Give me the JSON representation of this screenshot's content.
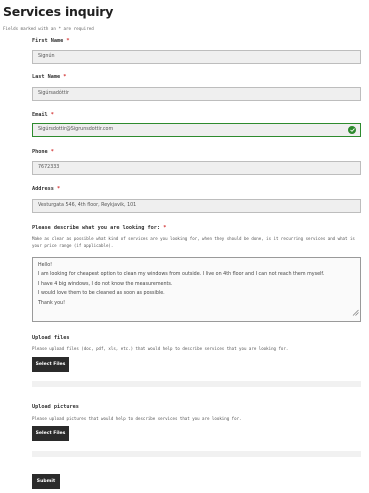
{
  "form": {
    "title": "Services inquiry",
    "required_note": "Fields marked with an * are required",
    "fields": {
      "first_name": {
        "label": "First Name",
        "required": "*",
        "value": "Signún"
      },
      "last_name": {
        "label": "Last Name",
        "required": "*",
        "value": "Sigúrsadóttir"
      },
      "email": {
        "label": "Email",
        "required": "*",
        "value": "Sigúrsdottir@Sigrunsdottir.com",
        "status_icon": "check-circle-icon"
      },
      "phone": {
        "label": "Phone",
        "required": "*",
        "value": "7672333"
      },
      "address": {
        "label": "Address",
        "required": "*",
        "value": "Vesturgata 546, 4th floor, Reykjavik, 101"
      },
      "description": {
        "label": "Please describe what you are looking for:",
        "required": "*",
        "help": "Make as clear as possible what kind of services are you looking for, when they should be done, is it recurring services and what is your price range (if applicable).",
        "lines": [
          "Hello!",
          "I am looking for cheapest option to clean my windows from outside. I live on 4th floor and I can not reach them myself.",
          "I have 4 big windows, I do not know the measurements.",
          "I would love them to be cleaned as soon as possible.",
          "Thank you!"
        ]
      }
    },
    "upload_files": {
      "label": "Upload files",
      "help": "Please upload files (doc, pdf, xls, etc.) that would help to describe services that you are looking for.",
      "button": "Select Files"
    },
    "upload_pictures": {
      "label": "Upload pictures",
      "help": "Please upload pictures that would help to describe services that you are looking for.",
      "button": "Select Files"
    },
    "submit": "Submit"
  },
  "colors": {
    "accent_valid": "#2e8b2e",
    "required_star": "#d43a3a",
    "button_bg": "#2b2b2b"
  }
}
